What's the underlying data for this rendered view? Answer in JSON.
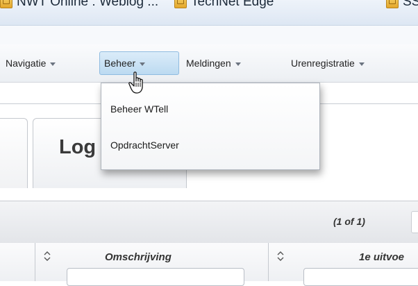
{
  "bookmarks": [
    {
      "label": "NWT Online : Weblog ..."
    },
    {
      "label": "TechNet Edge"
    },
    {
      "label": "SSI"
    }
  ],
  "menubar": {
    "items": [
      {
        "label": "Navigatie"
      },
      {
        "label": "Beheer"
      },
      {
        "label": "Meldingen"
      },
      {
        "label": "Urenregistratie"
      }
    ],
    "active": "Beheer"
  },
  "dropdown": {
    "items": [
      {
        "label": "Beheer WTell"
      },
      {
        "label": "OpdrachtServer"
      }
    ]
  },
  "tabs": [
    {
      "label": ""
    },
    {
      "label": "Log"
    }
  ],
  "paginator": {
    "text": "(1 of 1)"
  },
  "table": {
    "columns": [
      {
        "label": ""
      },
      {
        "label": "Omschrijving"
      },
      {
        "label": "1e uitvoe"
      }
    ]
  },
  "colors": {
    "menu_active": "#bcdaf1",
    "border": "#c7ccd3"
  }
}
